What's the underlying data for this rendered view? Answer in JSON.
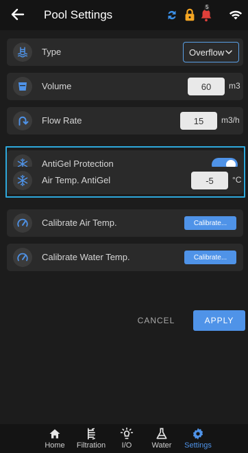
{
  "header": {
    "title": "Pool Settings",
    "notification_count": "5",
    "icons": [
      "back-arrow-icon",
      "sync-icon",
      "lock-icon",
      "bell-icon",
      "wifi-icon"
    ]
  },
  "settings": {
    "type": {
      "label": "Type",
      "value": "Overflow"
    },
    "volume": {
      "label": "Volume",
      "value": "60",
      "unit": "m3"
    },
    "flow_rate": {
      "label": "Flow Rate",
      "value": "15",
      "unit": "m3/h"
    },
    "antigel": {
      "label": "AntiGel Protection",
      "enabled": true
    },
    "air_temp_antigel": {
      "label": "Air Temp. AntiGel",
      "value": "-5",
      "unit": "°C"
    },
    "calibrate_air": {
      "label": "Calibrate Air Temp.",
      "button": "Calibrate..."
    },
    "calibrate_water": {
      "label": "Calibrate Water Temp.",
      "button": "Calibrate..."
    }
  },
  "actions": {
    "cancel": "CANCEL",
    "apply": "APPLY"
  },
  "nav": {
    "items": [
      {
        "label": "Home",
        "icon": "home-icon"
      },
      {
        "label": "Filtration",
        "icon": "filtration-icon"
      },
      {
        "label": "I/O",
        "icon": "bulb-icon"
      },
      {
        "label": "Water",
        "icon": "flask-icon"
      },
      {
        "label": "Settings",
        "icon": "gear-icon"
      }
    ],
    "active": "Settings"
  },
  "colors": {
    "accent": "#4f93e8",
    "highlight": "#2ea8dc",
    "warning": "#f5a623",
    "alert": "#e0403a"
  }
}
